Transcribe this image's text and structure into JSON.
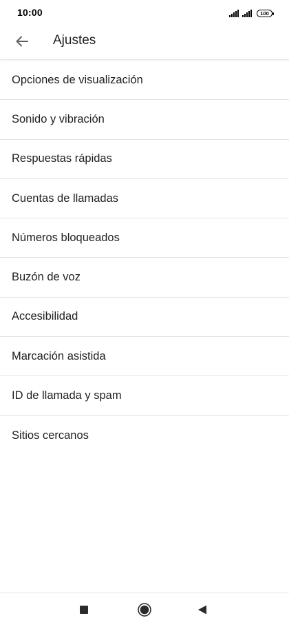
{
  "status_bar": {
    "time": "10:00",
    "battery": "100"
  },
  "app_bar": {
    "title": "Ajustes",
    "back_icon": "arrow-left-icon"
  },
  "settings": {
    "items": [
      {
        "label": "Opciones de visualización"
      },
      {
        "label": "Sonido y vibración"
      },
      {
        "label": "Respuestas rápidas"
      },
      {
        "label": "Cuentas de llamadas"
      },
      {
        "label": "Números bloqueados"
      },
      {
        "label": "Buzón de voz"
      },
      {
        "label": "Accesibilidad"
      },
      {
        "label": "Marcación asistida"
      },
      {
        "label": "ID de llamada y spam"
      },
      {
        "label": "Sitios cercanos"
      }
    ]
  },
  "nav_bar": {
    "recents_icon": "square-icon",
    "home_icon": "circle-icon",
    "back_icon": "triangle-left-icon"
  },
  "colors": {
    "text": "#202124",
    "divider": "#e2e2e2",
    "background": "#ffffff"
  }
}
